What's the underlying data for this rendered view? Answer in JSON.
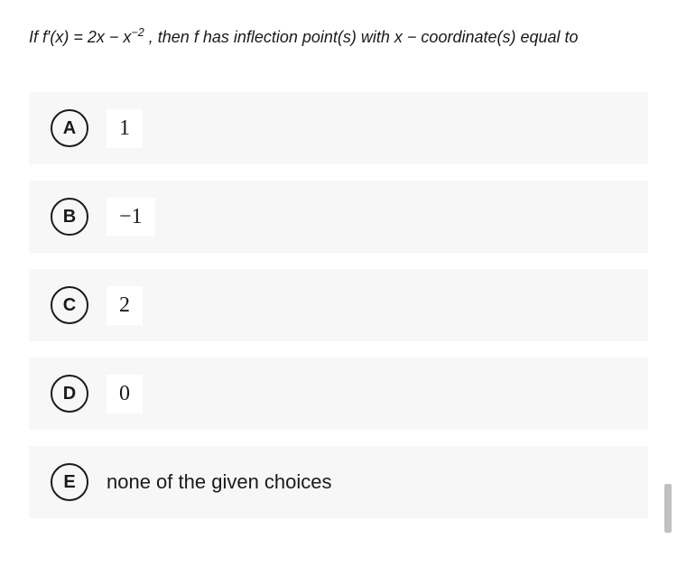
{
  "question": {
    "prefix": "If ",
    "expression": "f′(x) = 2x − x",
    "exponent": "−2",
    "suffix": " , then f has inflection point(s) with x − coordinate(s) equal to"
  },
  "options": [
    {
      "letter": "A",
      "value": "1",
      "boxed": true
    },
    {
      "letter": "B",
      "value": "−1",
      "boxed": true
    },
    {
      "letter": "C",
      "value": "2",
      "boxed": true
    },
    {
      "letter": "D",
      "value": "0",
      "boxed": true
    },
    {
      "letter": "E",
      "value": "none of the given choices",
      "boxed": false
    }
  ]
}
